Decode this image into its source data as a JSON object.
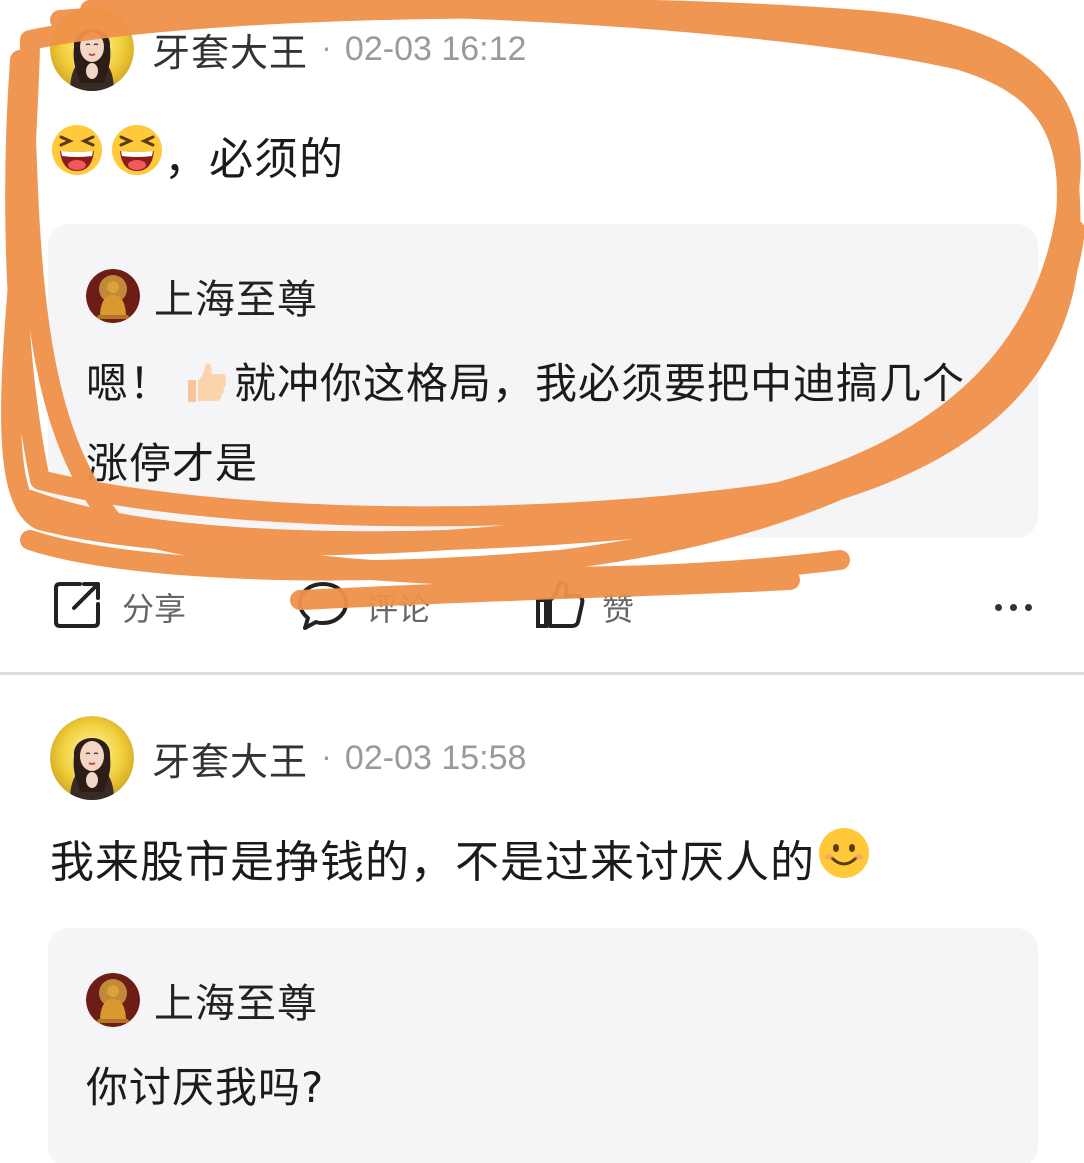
{
  "posts": [
    {
      "author": "牙套大王",
      "separator": "·",
      "time": "02-03 16:12",
      "text": "，必须的",
      "leading_emoji": [
        "laughing-emoji",
        "laughing-emoji"
      ],
      "quote": {
        "author": "上海至尊",
        "text_before_emoji": "嗯！",
        "emoji": "thumbs-up-emoji",
        "text_after_emoji": "就冲你这格局，我必须要把中迪搞几个涨停才是"
      },
      "actions": {
        "share": "分享",
        "comment": "评论",
        "like": "赞"
      }
    },
    {
      "author": "牙套大王",
      "separator": "·",
      "time": "02-03 15:58",
      "text": "我来股市是挣钱的，不是过来讨厌人的",
      "trailing_emoji": "smile-emoji",
      "quote": {
        "author": "上海至尊",
        "text": "你讨厌我吗?"
      }
    }
  ],
  "colors": {
    "scribble": "#f0914a",
    "quote_bg": "#f5f5f8",
    "meta_gray": "#9a9a9a"
  }
}
